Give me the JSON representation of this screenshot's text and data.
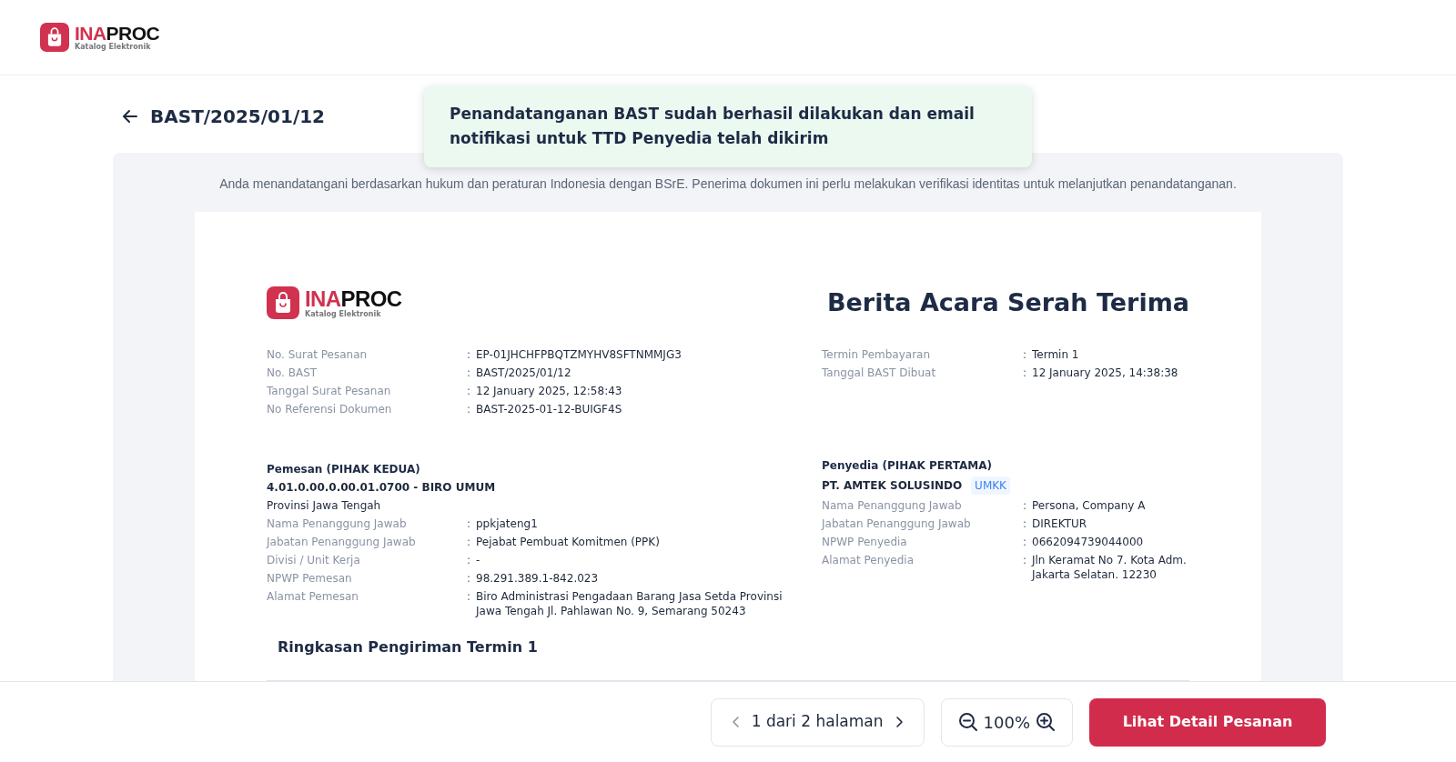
{
  "header": {
    "logo": {
      "brand_a": "INA",
      "brand_b": "PROC",
      "tagline": "Katalog Elektronik"
    }
  },
  "page": {
    "title": "BAST/2025/01/12"
  },
  "toast": {
    "message": "Penandatanganan BAST sudah berhasil dilakukan dan email notifikasi untuk TTD Penyedia telah dikirim"
  },
  "notice": "Anda menandatangani berdasarkan hukum dan peraturan Indonesia dengan BSrE. Penerima dokumen ini perlu melakukan verifikasi identitas untuk melanjutkan penandatanganan.",
  "document": {
    "logo": {
      "brand_a": "INA",
      "brand_b": "PROC",
      "tagline": "Katalog Elektronik"
    },
    "title": "Berita Acara Serah Terima",
    "info_left": [
      {
        "label": "No. Surat Pesanan",
        "separator": ":",
        "value": "EP-01JHCHFPBQTZMYHV8SFTNMMJG3"
      },
      {
        "label": "No. BAST",
        "separator": ":",
        "value": "BAST/2025/01/12"
      },
      {
        "label": "Tanggal Surat Pesanan",
        "separator": ":",
        "value": "12 January 2025, 12:58:43"
      },
      {
        "label": "No Referensi Dokumen",
        "separator": ":",
        "value": "BAST-2025-01-12-BUIGF4S"
      }
    ],
    "info_right": [
      {
        "label": "Termin Pembayaran",
        "separator": ":",
        "value": "Termin 1"
      },
      {
        "label": "Tanggal BAST Dibuat",
        "separator": ":",
        "value": "12 January 2025, 14:38:38"
      }
    ],
    "buyer": {
      "heading": "Pemesan (PIHAK KEDUA)",
      "name": "4.01.0.00.0.00.01.0700 - BIRO UMUM",
      "region": "Provinsi Jawa Tengah",
      "fields": [
        {
          "label": "Nama Penanggung Jawab",
          "separator": ":",
          "value": "ppkjateng1"
        },
        {
          "label": "Jabatan Penanggung Jawab",
          "separator": ":",
          "value": "Pejabat Pembuat Komitmen (PPK)"
        },
        {
          "label": "Divisi / Unit Kerja",
          "separator": ":",
          "value": "-"
        },
        {
          "label": "NPWP Pemesan",
          "separator": ":",
          "value": "98.291.389.1-842.023"
        },
        {
          "label": "Alamat Pemesan",
          "separator": ":",
          "value": "Biro Administrasi Pengadaan Barang Jasa Setda Provinsi Jawa Tengah Jl. Pahlawan No. 9, Semarang 50243"
        }
      ]
    },
    "seller": {
      "heading": "Penyedia (PIHAK PERTAMA)",
      "name": "PT. AMTEK SOLUSINDO",
      "badge": "UMKK",
      "fields": [
        {
          "label": "Nama Penanggung Jawab",
          "separator": ":",
          "value": "Persona, Company A"
        },
        {
          "label": "Jabatan Penanggung Jawab",
          "separator": ":",
          "value": "DIREKTUR"
        },
        {
          "label": "NPWP Penyedia",
          "separator": ":",
          "value": "0662094739044000"
        },
        {
          "label": "Alamat Penyedia",
          "separator": ":",
          "value": "Jln Keramat No 7. Kota Adm. Jakarta Selatan. 12230"
        }
      ]
    },
    "summary_heading": "Ringkasan Pengiriman Termin 1"
  },
  "footer": {
    "pager": {
      "text": "1 dari 2 halaman",
      "prev_disabled": true,
      "next_disabled": false
    },
    "zoom": "100%",
    "primary_button": "Lihat Detail Pesanan"
  }
}
